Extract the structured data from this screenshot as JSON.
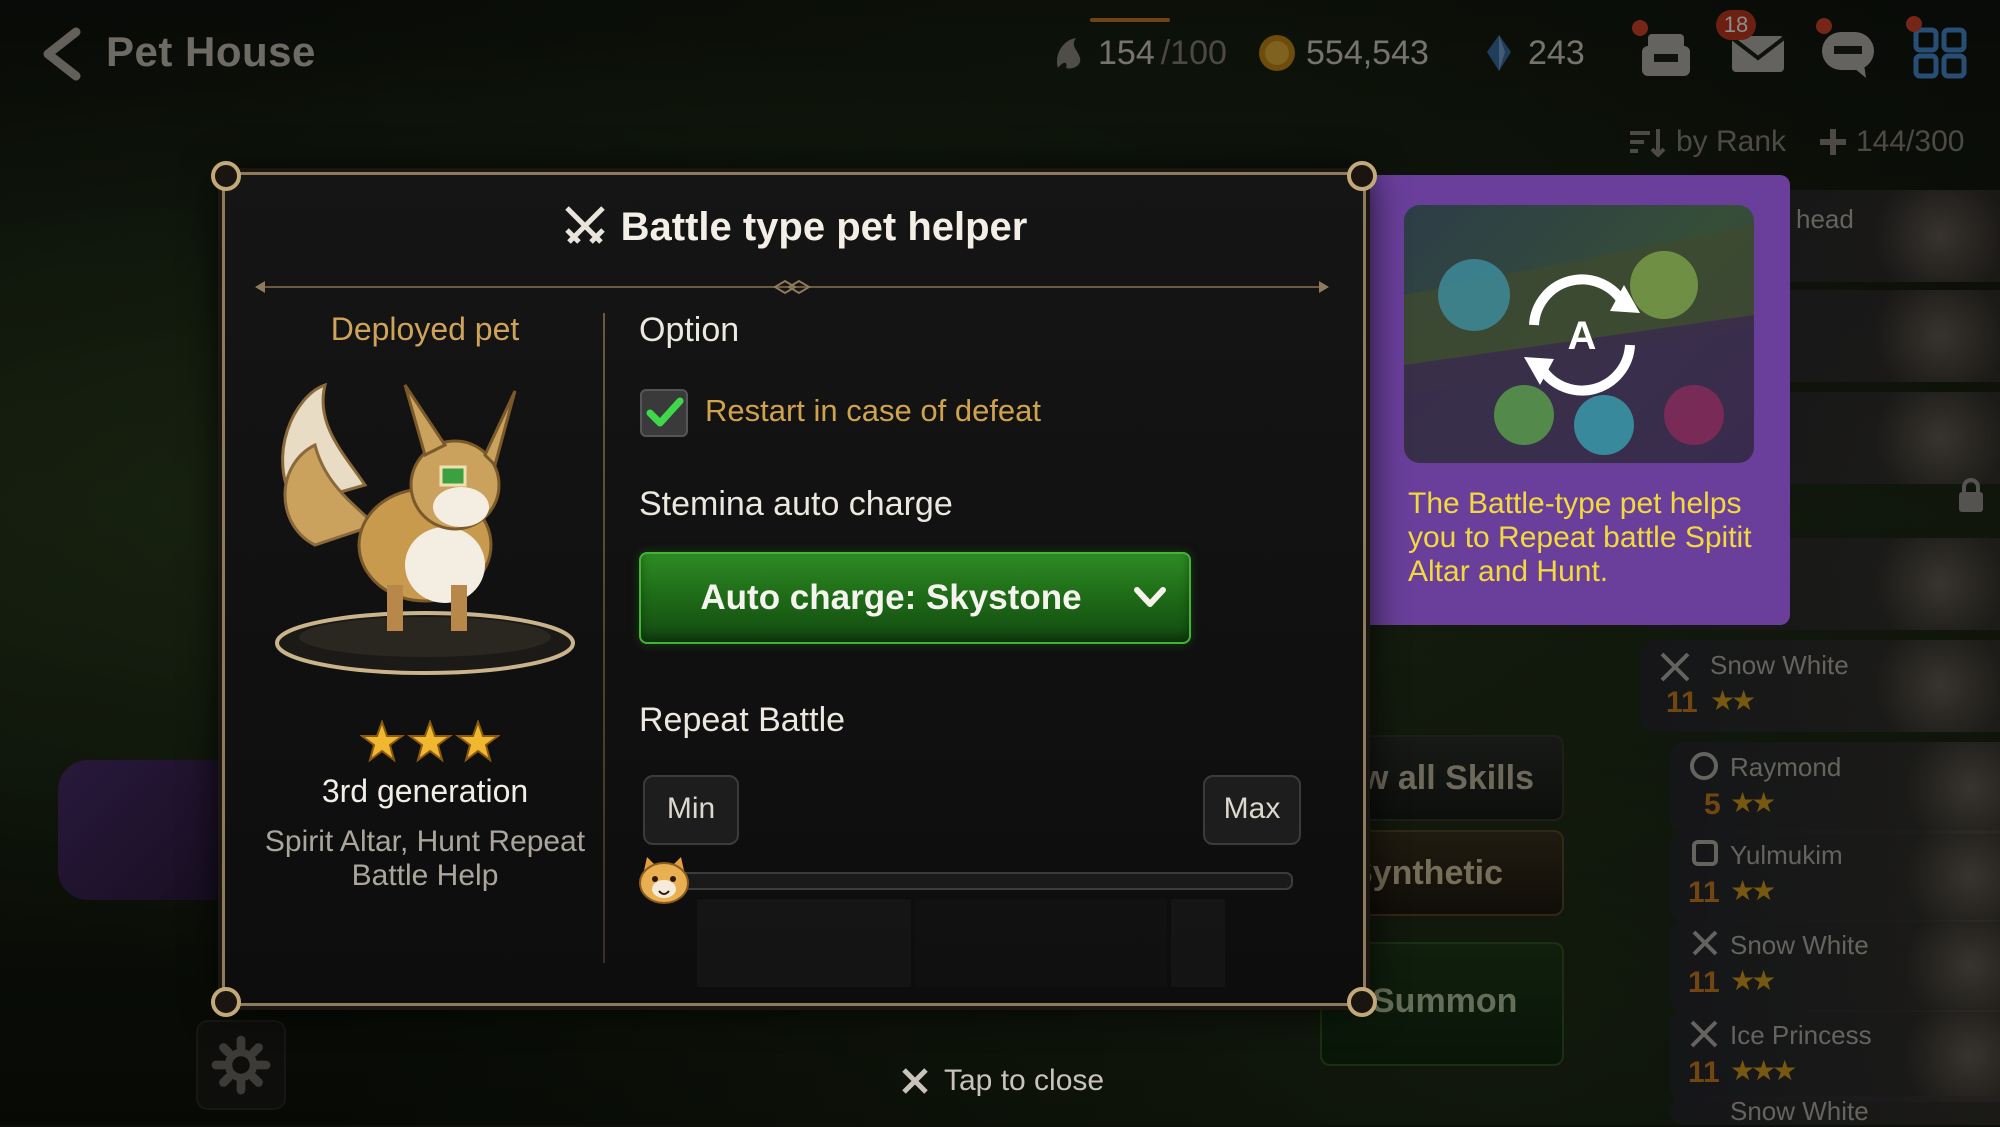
{
  "header": {
    "title": "Pet House",
    "stamina": {
      "current": "154",
      "max": "/100"
    },
    "gold": "554,543",
    "skystone": "243",
    "mail_badge": "18"
  },
  "sort": {
    "label": "by Rank",
    "count": "144/300"
  },
  "pet_list": [
    {
      "name": "head",
      "level": "",
      "stars": ""
    },
    {
      "name": "Snow White",
      "level": "11",
      "stars": "★★"
    },
    {
      "name": "Raymond",
      "level": "5",
      "stars": "★★"
    },
    {
      "name": "Yulmukim",
      "level": "11",
      "stars": "★★"
    },
    {
      "name": "Snow White",
      "level": "11",
      "stars": "★★"
    },
    {
      "name": "Ice Princess",
      "level": "11",
      "stars": "★★★"
    },
    {
      "name": "Snow White",
      "level": "",
      "stars": ""
    }
  ],
  "side_buttons": [
    "w all Skills",
    "Synthetic",
    "Summon"
  ],
  "info_card": {
    "text": "The Battle-type pet helps you to Repeat battle Spitit Altar and Hunt."
  },
  "dialog": {
    "title": "Battle type pet helper",
    "deployed_label": "Deployed pet",
    "generation": "3rd generation",
    "description": "Spirit Altar, Hunt Repeat Battle Help",
    "option_label": "Option",
    "restart_label": "Restart in case of defeat",
    "restart_checked": true,
    "stamina_label": "Stemina auto charge",
    "auto_charge_value": "Auto charge: Skystone",
    "repeat_label": "Repeat Battle",
    "min_label": "Min",
    "max_label": "Max",
    "repeat_value": 0
  },
  "tap_to_close": "Tap to close",
  "colors": {
    "accent_green": "#2e8c24",
    "gold_text": "#cfa24e",
    "info_purple": "#6a3f9c",
    "info_text": "#f2d93c"
  }
}
